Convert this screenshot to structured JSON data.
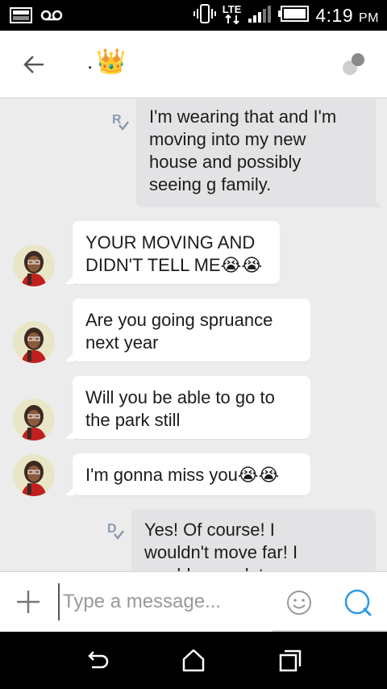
{
  "status_bar": {
    "time": "4:19",
    "ampm": "PM",
    "network": "LTE",
    "icons": [
      "image-icon",
      "voicemail-icon",
      "vibrate-icon",
      "lte-icon",
      "signal-icon",
      "battery-icon"
    ]
  },
  "header": {
    "contact_prefix": ".",
    "contact_emoji": "👑",
    "back_icon": "arrow-left-icon",
    "menu_icon": "conversation-options-icon"
  },
  "messages": [
    {
      "direction": "outgoing",
      "status": "R",
      "lines": [
        "I'm wearing that and I'm",
        "moving into my new",
        "house and possibly",
        "seeing g family."
      ]
    },
    {
      "direction": "incoming",
      "lines": [
        "YOUR MOVING AND",
        "DIDN'T TELL ME😭😭"
      ]
    },
    {
      "direction": "incoming",
      "lines": [
        "Are you going spruance",
        "next year"
      ]
    },
    {
      "direction": "incoming",
      "lines": [
        "Will you be able to go to",
        "the park still"
      ]
    },
    {
      "direction": "incoming",
      "lines": [
        "I'm gonna miss you😭😭"
      ]
    },
    {
      "direction": "outgoing",
      "status": "D",
      "lines": [
        "Yes! Of course! I",
        "wouldn't move far! I",
        "would never let my mom"
      ]
    }
  ],
  "composer": {
    "placeholder": "Type a message...",
    "value": "",
    "add_icon": "plus-icon",
    "emoji_icon": "smiley-icon",
    "send_icon": "chat-bubble-icon"
  },
  "navigation": [
    "back-icon",
    "home-icon",
    "recent-apps-icon"
  ],
  "colors": {
    "status_bar": "#000000",
    "outgoing_bubble": "#e3e3e6",
    "incoming_bubble": "#ffffff",
    "background": "#ececec",
    "accent": "#2c9ae8"
  }
}
